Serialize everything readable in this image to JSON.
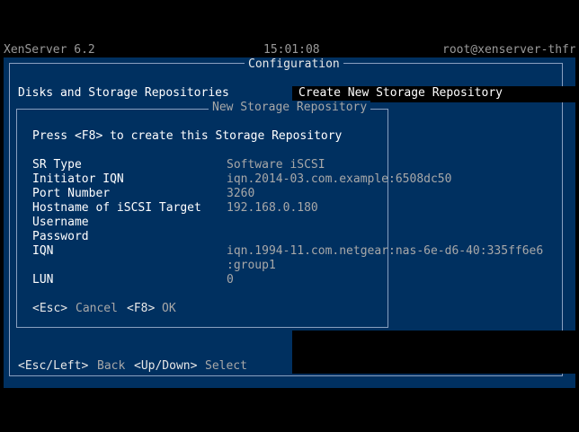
{
  "topbar": {
    "product": "XenServer 6.2",
    "time": "15:01:08",
    "host": "root@xenserver-thfr"
  },
  "main": {
    "title": "Configuration",
    "left_menu_item": "Disks and Storage Repositories",
    "right_title": "Create New Storage Repository",
    "footer": {
      "key1": "<Esc/Left>",
      "label1": "Back",
      "key2": "<Up/Down>",
      "label2": "Select"
    }
  },
  "dialog": {
    "title": "New Storage Repository",
    "instruction": "Press <F8> to create this Storage Repository",
    "fields": [
      {
        "label": "SR Type",
        "value": "Software iSCSI"
      },
      {
        "label": "Initiator IQN",
        "value": "iqn.2014-03.com.example:6508dc50"
      },
      {
        "label": "Port Number",
        "value": "3260"
      },
      {
        "label": "Hostname of iSCSI Target",
        "value": "192.168.0.180"
      },
      {
        "label": "Username",
        "value": ""
      },
      {
        "label": "Password",
        "value": ""
      },
      {
        "label": "IQN",
        "value": "iqn.1994-11.com.netgear:nas-6e-d6-40:335ff6e6"
      },
      {
        "label": "",
        "value": ":group1"
      },
      {
        "label": "LUN",
        "value": "0"
      }
    ],
    "actions": {
      "cancel_key": "<Esc>",
      "cancel_label": "Cancel",
      "ok_key": "<F8>",
      "ok_label": "OK"
    }
  }
}
